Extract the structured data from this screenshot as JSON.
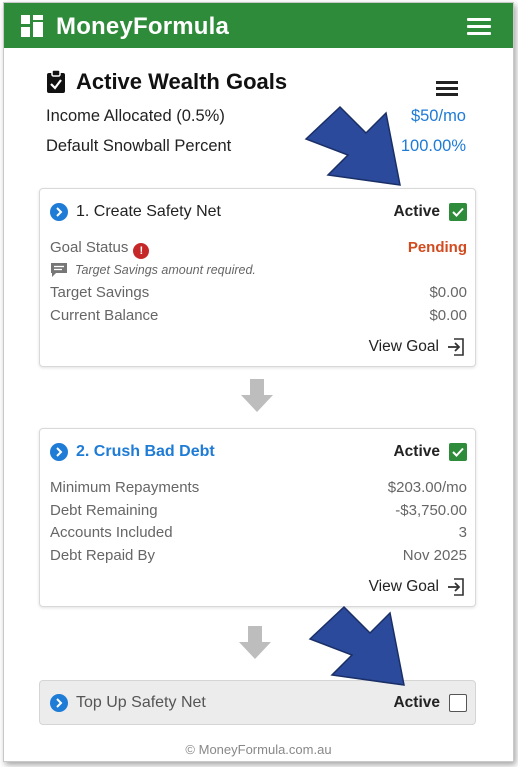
{
  "app": {
    "brand": "MoneyFormula"
  },
  "page": {
    "title": "Active Wealth Goals"
  },
  "summary": [
    {
      "label": "Income Allocated (0.5%)",
      "value": "$50/mo"
    },
    {
      "label": "Default Snowball Percent",
      "value": "100.00%"
    }
  ],
  "goal1": {
    "title": "1. Create Safety Net",
    "active_label": "Active",
    "status_label": "Goal Status",
    "status_alert": "!",
    "status_value": "Pending",
    "note": "Target Savings amount required.",
    "rows": [
      {
        "label": "Target Savings",
        "value": "$0.00"
      },
      {
        "label": "Current Balance",
        "value": "$0.00"
      }
    ],
    "view_label": "View Goal"
  },
  "goal2": {
    "title": "2. Crush Bad Debt",
    "active_label": "Active",
    "rows": [
      {
        "label": "Minimum Repayments",
        "value": "$203.00/mo"
      },
      {
        "label": "Debt Remaining",
        "value": "-$3,750.00"
      },
      {
        "label": "Accounts Included",
        "value": "3"
      },
      {
        "label": "Debt Repaid By",
        "value": "Nov 2025"
      }
    ],
    "view_label": "View Goal"
  },
  "goal3": {
    "title": "Top Up Safety Net",
    "active_label": "Active",
    "checked": false
  },
  "footer": {
    "text": "© MoneyFormula.com.au"
  },
  "colors": {
    "brand_green": "#2e8b3a",
    "link_blue": "#1e7bd6",
    "pending": "#d14b1f",
    "callout_arrow": "#2b4a9c"
  },
  "icons": {
    "logo": "grid-logo-icon",
    "menu": "hamburger-menu-icon",
    "title": "clipboard-check-icon",
    "list": "list-icon",
    "chevron": "chevron-right-circle-icon",
    "check": "checkbox-checked-icon",
    "alert": "alert-circle-icon",
    "note": "comment-icon",
    "view": "sign-in-icon",
    "step": "arrow-down-icon"
  }
}
